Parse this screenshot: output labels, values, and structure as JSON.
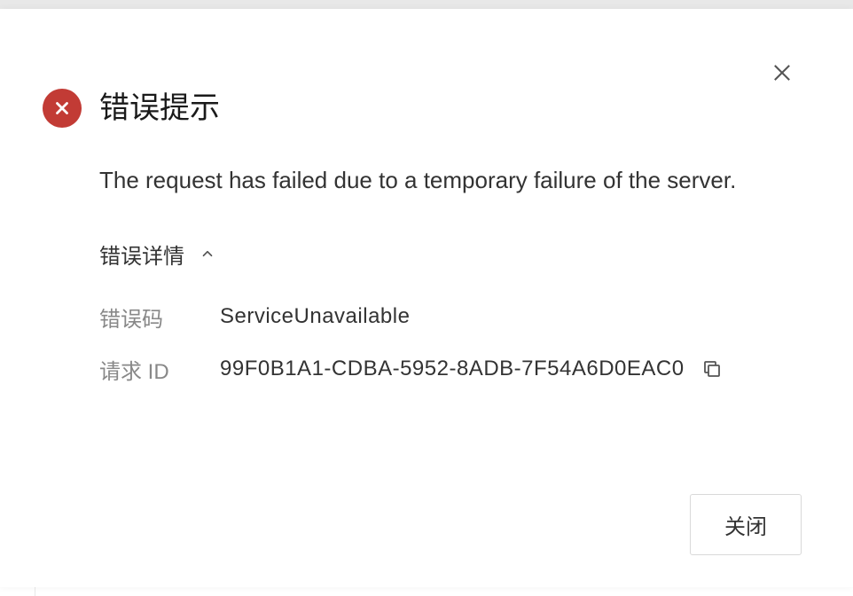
{
  "modal": {
    "title": "错误提示",
    "message": "The request has failed due to a temporary failure of the server.",
    "detailsToggleLabel": "错误详情",
    "errorCodeLabel": "错误码",
    "errorCodeValue": "ServiceUnavailable",
    "requestIdLabel": "请求 ID",
    "requestIdValue": "99F0B1A1-CDBA-5952-8ADB-7F54A6D0EAC0",
    "closeButtonLabel": "关闭"
  }
}
